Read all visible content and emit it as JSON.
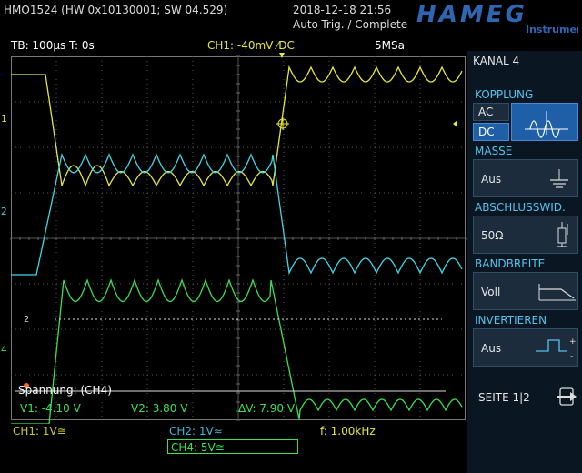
{
  "header": {
    "device": "HMO1524 (HW 0x10130001; SW 04.529)",
    "datetime": "2018-12-18 21:56",
    "trigger_status": "Auto-Trig. / Complete",
    "brand": "HAMEG",
    "brand_sub": "Instruments"
  },
  "status_line": {
    "timebase": "TB: 100µs   T: 0s",
    "ch1_trigger": "CH1: -40mV ⁄DC",
    "sample_rate": "5MSa"
  },
  "markers": {
    "ch1_label": "1",
    "ch2_label": "2",
    "ch4_label": "4",
    "cursor_label": "2"
  },
  "measurement": {
    "title": "Spannung: (CH4)",
    "v1": "V1: -4.10 V",
    "v2": "V2: 3.80 V",
    "dv": "ΔV: 7.90 V"
  },
  "channels_bar": {
    "ch1": "CH1: 1V≅",
    "ch2": "CH2: 1V≈",
    "freq": "f: 1.00kHz",
    "ch4": "CH4: 5V≅"
  },
  "menu": {
    "title": "KANAL 4",
    "kopplung": {
      "label": "KOPPLUNG",
      "options": [
        "AC",
        "DC"
      ],
      "selected": "DC"
    },
    "masse": {
      "label": "MASSE",
      "value": "Aus"
    },
    "abschluss": {
      "label": "ABSCHLUSSWID.",
      "value": "50Ω"
    },
    "bandbreite": {
      "label": "BANDBREITE",
      "value": "Voll"
    },
    "invertieren": {
      "label": "INVERTIEREN",
      "value": "Aus"
    },
    "page": "SEITE 1|2"
  },
  "colors": {
    "ch1": "#e7e73a",
    "ch2": "#3fd6e8",
    "ch4": "#39e051",
    "menu_title": "#54c3ee",
    "logo": "#2f66b3"
  }
}
